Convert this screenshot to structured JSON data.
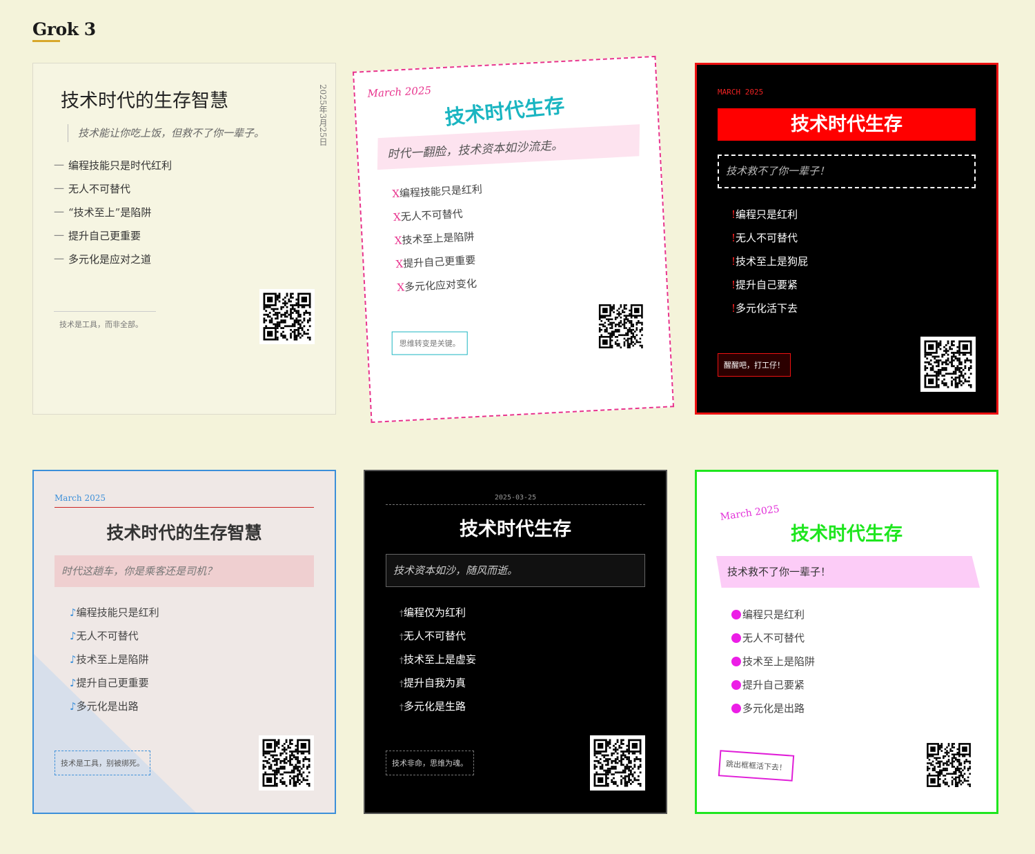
{
  "page": {
    "title": "Grok 3"
  },
  "cards": [
    {
      "title": "技术时代的生存智慧",
      "vertical_date": "2025年3月25日",
      "quote": "技术能让你吃上饭，但救不了你一辈子。",
      "marker": "一",
      "items": [
        "编程技能只是时代红利",
        "无人不可替代",
        "“技术至上”是陷阱",
        "提升自己更重要",
        "多元化是应对之道"
      ],
      "footer": "技术是工具，而非全部。"
    },
    {
      "date": "March 2025",
      "title": "技术时代生存",
      "quote": "时代一翻脸，技术资本如沙流走。",
      "marker": "X",
      "items": [
        "编程技能只是红利",
        "无人不可替代",
        "技术至上是陷阱",
        "提升自己更重要",
        "多元化应对变化"
      ],
      "footer": "思维转变是关键。"
    },
    {
      "date": "MARCH 2025",
      "title": "技术时代生存",
      "quote": "技术救不了你一辈子！",
      "marker": "!",
      "items": [
        "编程只是红利",
        "无人不可替代",
        "技术至上是狗屁",
        "提升自己要紧",
        "多元化活下去"
      ],
      "footer": "醒醒吧，打工仔！"
    },
    {
      "date": "March 2025",
      "title": "技术时代的生存智慧",
      "quote": "时代这趟车，你是乘客还是司机？",
      "marker": "♪",
      "items": [
        "编程技能只是红利",
        "无人不可替代",
        "技术至上是陷阱",
        "提升自己更重要",
        "多元化是出路"
      ],
      "footer": "技术是工具，别被绑死。"
    },
    {
      "date": "2025-03-25",
      "title": "技术时代生存",
      "quote": "技术资本如沙，随风而逝。",
      "marker": "†",
      "items": [
        "编程仅为红利",
        "无人不可替代",
        "技术至上是虚妄",
        "提升自我为真",
        "多元化是生路"
      ],
      "footer": "技术非命，思维为魂。"
    },
    {
      "date": "March 2025",
      "title": "技术时代生存",
      "quote": "技术救不了你一辈子！",
      "items": [
        "编程只是红利",
        "无人不可替代",
        "技术至上是陷阱",
        "提升自己要紧",
        "多元化是出路"
      ],
      "footer": "跳出框框活下去！"
    }
  ],
  "colors": {
    "background": "#f4f3da",
    "title_underline": "#d8a72b",
    "card2_accent": "#e8338d",
    "card2_title": "#1ab5c1",
    "card3_accent": "#ff0000",
    "card4_accent": "#3b8fd9",
    "card6_border": "#1ee61e",
    "card6_accent": "#ec1ee6"
  },
  "icons": [
    "qr-code-icon"
  ]
}
